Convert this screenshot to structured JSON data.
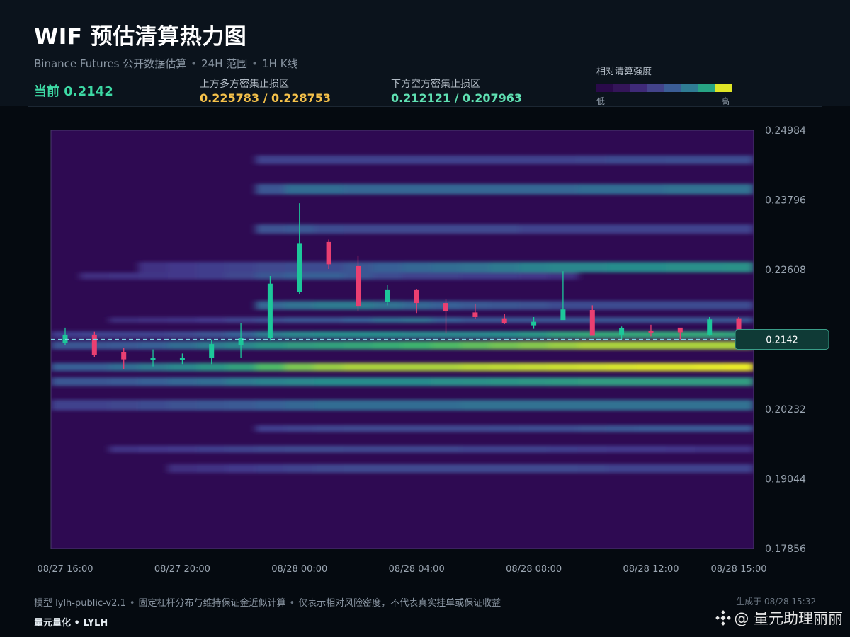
{
  "header": {
    "title": "WIF 预估清算热力图",
    "subtitle_source": "Binance Futures 公开数据估算",
    "subtitle_range": "24H 范围",
    "subtitle_interval": "1H K线",
    "separator": "•",
    "current_label": "当前 0.2142",
    "upper_zone_label": "上方多方密集止损区",
    "upper_zone_value": "0.225783 / 0.228753",
    "lower_zone_label": "下方空方密集止损区",
    "lower_zone_value": "0.212121 / 0.207963"
  },
  "legend": {
    "label": "相对清算强度",
    "low": "低",
    "high": "高",
    "colors": [
      "#2a0a4a",
      "#341559",
      "#3f2a78",
      "#43438a",
      "#3b5d96",
      "#2f7c94",
      "#27a484",
      "#dfe526"
    ]
  },
  "chart_data": {
    "type": "candlestick-heatmap",
    "symbol": "WIF",
    "x_tick_labels": [
      "08/27 16:00",
      "08/27 20:00",
      "08/28 00:00",
      "08/28 04:00",
      "08/28 08:00",
      "08/28 12:00",
      "08/28 15:00"
    ],
    "y_tick_labels": [
      "0.24984",
      "0.23796",
      "0.22608",
      "0.21420",
      "0.20232",
      "0.19044",
      "0.17856"
    ],
    "ylim": [
      0.17856,
      0.24984
    ],
    "current_price": 0.2142,
    "current_price_label": "0.2142",
    "up_color": "#1dc79a",
    "down_color": "#ea3f71",
    "candles": [
      {
        "o": 0.2136,
        "h": 0.2162,
        "l": 0.2132,
        "c": 0.215
      },
      {
        "o": 0.215,
        "h": 0.2155,
        "l": 0.2112,
        "c": 0.2116
      },
      {
        "o": 0.212,
        "h": 0.2128,
        "l": 0.2092,
        "c": 0.2108
      },
      {
        "o": 0.2108,
        "h": 0.2125,
        "l": 0.2096,
        "c": 0.211
      },
      {
        "o": 0.2108,
        "h": 0.2118,
        "l": 0.21,
        "c": 0.211
      },
      {
        "o": 0.211,
        "h": 0.2142,
        "l": 0.21,
        "c": 0.2134
      },
      {
        "o": 0.2132,
        "h": 0.217,
        "l": 0.211,
        "c": 0.2145
      },
      {
        "o": 0.2145,
        "h": 0.225,
        "l": 0.214,
        "c": 0.2237
      },
      {
        "o": 0.2223,
        "h": 0.2374,
        "l": 0.2219,
        "c": 0.2305
      },
      {
        "o": 0.2308,
        "h": 0.2312,
        "l": 0.2262,
        "c": 0.227
      },
      {
        "o": 0.2267,
        "h": 0.2285,
        "l": 0.219,
        "c": 0.2198
      },
      {
        "o": 0.2206,
        "h": 0.2235,
        "l": 0.22,
        "c": 0.2226
      },
      {
        "o": 0.2226,
        "h": 0.2228,
        "l": 0.2187,
        "c": 0.2204
      },
      {
        "o": 0.2204,
        "h": 0.221,
        "l": 0.2152,
        "c": 0.219
      },
      {
        "o": 0.2188,
        "h": 0.2203,
        "l": 0.2177,
        "c": 0.218
      },
      {
        "o": 0.2178,
        "h": 0.2185,
        "l": 0.2168,
        "c": 0.217
      },
      {
        "o": 0.2166,
        "h": 0.218,
        "l": 0.216,
        "c": 0.2172
      },
      {
        "o": 0.2175,
        "h": 0.2258,
        "l": 0.2176,
        "c": 0.2193
      },
      {
        "o": 0.2192,
        "h": 0.22,
        "l": 0.2148,
        "c": 0.2148
      },
      {
        "o": 0.215,
        "h": 0.2164,
        "l": 0.2142,
        "c": 0.2161
      },
      {
        "o": 0.2156,
        "h": 0.2167,
        "l": 0.2147,
        "c": 0.2155
      },
      {
        "o": 0.2162,
        "h": 0.2158,
        "l": 0.2142,
        "c": 0.2154
      },
      {
        "o": 0.215,
        "h": 0.218,
        "l": 0.2148,
        "c": 0.2176
      },
      {
        "o": 0.2178,
        "h": 0.218,
        "l": 0.215,
        "c": 0.2158
      }
    ],
    "heat_bands": [
      {
        "price": 0.2448,
        "width": 0.0015,
        "levels": [
          0,
          0,
          0,
          0,
          0,
          0,
          0,
          0.3,
          0.3,
          0.3,
          0.3,
          0.3,
          0.3,
          0.3,
          0.3,
          0.3,
          0.3,
          0.3,
          0.32,
          0.35,
          0.35,
          0.36,
          0.36,
          0.36
        ]
      },
      {
        "price": 0.2398,
        "width": 0.0018,
        "levels": [
          0,
          0,
          0,
          0,
          0,
          0,
          0,
          0.4,
          0.5,
          0.5,
          0.48,
          0.48,
          0.48,
          0.48,
          0.48,
          0.48,
          0.48,
          0.48,
          0.5,
          0.5,
          0.5,
          0.52,
          0.52,
          0.52
        ]
      },
      {
        "price": 0.233,
        "width": 0.0016,
        "levels": [
          0,
          0,
          0,
          0,
          0,
          0,
          0,
          0.38,
          0.4,
          0.35,
          0.33,
          0.33,
          0.33,
          0.33,
          0.33,
          0.33,
          0.3,
          0.3,
          0.3,
          0.3,
          0.3,
          0.3,
          0.3,
          0.3
        ]
      },
      {
        "price": 0.2265,
        "width": 0.0018,
        "levels": [
          0,
          0,
          0,
          0.22,
          0.25,
          0.28,
          0.3,
          0.33,
          0.35,
          0.35,
          0.4,
          0.45,
          0.48,
          0.5,
          0.52,
          0.55,
          0.58,
          0.6,
          0.6,
          0.62,
          0.62,
          0.63,
          0.63,
          0.64
        ]
      },
      {
        "price": 0.225,
        "width": 0.0012,
        "levels": [
          0,
          0.2,
          0.22,
          0.23,
          0.25,
          0.28,
          0.32,
          0.4,
          0.45,
          0.45,
          0.4,
          0.35,
          0.3,
          0.3,
          0.28,
          0.28,
          0.25,
          0.22,
          0,
          0,
          0,
          0,
          0,
          0
        ]
      },
      {
        "price": 0.22,
        "width": 0.0015,
        "levels": [
          0,
          0,
          0,
          0,
          0,
          0,
          0,
          0.48,
          0.52,
          0.55,
          0.55,
          0.52,
          0.48,
          0.45,
          0.42,
          0.4,
          0.38,
          0.35,
          0.35,
          0.35,
          0.35,
          0.35,
          0.35,
          0.35
        ]
      },
      {
        "price": 0.2175,
        "width": 0.001,
        "levels": [
          0,
          0,
          0.18,
          0.2,
          0.22,
          0.25,
          0.3,
          0.35,
          0.4,
          0.4,
          0.45,
          0.5,
          0.52,
          0.45,
          0.4,
          0.4,
          0.4,
          0.4,
          0.4,
          0.4,
          0.4,
          0.4,
          0.4,
          0.4
        ]
      },
      {
        "price": 0.215,
        "width": 0.0012,
        "levels": [
          0.28,
          0.3,
          0.3,
          0.3,
          0.33,
          0.38,
          0.45,
          0.55,
          0.6,
          0.62,
          0.62,
          0.62,
          0.6,
          0.6,
          0.6,
          0.62,
          0.65,
          0.7,
          0.72,
          0.72,
          0.72,
          0.72,
          0.72,
          0.7
        ]
      },
      {
        "price": 0.2132,
        "width": 0.0014,
        "levels": [
          0.4,
          0.4,
          0.42,
          0.45,
          0.5,
          0.55,
          0.6,
          0.65,
          0.68,
          0.7,
          0.72,
          0.75,
          0.78,
          0.8,
          0.82,
          0.84,
          0.86,
          0.88,
          0.9,
          0.9,
          0.9,
          0.9,
          0.9,
          0.9
        ]
      },
      {
        "price": 0.2095,
        "width": 0.0014,
        "levels": [
          0.45,
          0.45,
          0.5,
          0.55,
          0.6,
          0.65,
          0.7,
          0.8,
          0.85,
          0.88,
          0.9,
          0.9,
          0.9,
          0.9,
          0.92,
          0.93,
          0.94,
          0.95,
          0.96,
          0.97,
          0.98,
          0.98,
          0.99,
          1.0
        ]
      },
      {
        "price": 0.207,
        "width": 0.0015,
        "levels": [
          0.4,
          0.4,
          0.42,
          0.45,
          0.48,
          0.5,
          0.55,
          0.58,
          0.6,
          0.62,
          0.62,
          0.62,
          0.62,
          0.63,
          0.64,
          0.65,
          0.66,
          0.67,
          0.68,
          0.68,
          0.68,
          0.68,
          0.68,
          0.68
        ]
      },
      {
        "price": 0.203,
        "width": 0.0018,
        "levels": [
          0.3,
          0.3,
          0.32,
          0.35,
          0.38,
          0.4,
          0.42,
          0.45,
          0.48,
          0.5,
          0.5,
          0.5,
          0.5,
          0.5,
          0.52,
          0.52,
          0.52,
          0.52,
          0.52,
          0.52,
          0.52,
          0.52,
          0.52,
          0.52
        ]
      },
      {
        "price": 0.199,
        "width": 0.0012,
        "levels": [
          0,
          0,
          0,
          0,
          0,
          0,
          0,
          0.28,
          0.3,
          0.32,
          0.33,
          0.33,
          0.33,
          0.33,
          0.33,
          0.35,
          0.36,
          0.36,
          0.38,
          0.4,
          0.42,
          0.42,
          0.42,
          0.42
        ]
      },
      {
        "price": 0.1955,
        "width": 0.0012,
        "levels": [
          0,
          0,
          0.22,
          0.24,
          0.25,
          0.28,
          0.3,
          0.32,
          0.33,
          0.33,
          0.32,
          0.32,
          0.32,
          0.32,
          0.3,
          0.3,
          0.3,
          0.28,
          0.26,
          0.25,
          0.25,
          0.24,
          0.22,
          0.22
        ]
      },
      {
        "price": 0.1922,
        "width": 0.0015,
        "levels": [
          0,
          0,
          0,
          0,
          0.2,
          0.22,
          0.25,
          0.28,
          0.3,
          0.32,
          0.33,
          0.33,
          0.33,
          0.33,
          0.33,
          0.33,
          0.33,
          0.33,
          0.32,
          0.3,
          0.3,
          0.3,
          0.3,
          0.3
        ]
      }
    ]
  },
  "footer": {
    "model": "模型 lylh-public-v2.1",
    "note_1": "固定杠杆分布与维持保证金近似计算",
    "note_2": "仅表示相对风险密度，不代表真实挂单或保证收益",
    "separator": "•",
    "brand": "量元量化 • LYLH",
    "generated": "生成于 08/28 15:32",
    "watermark": "@ 量元助理丽丽"
  }
}
